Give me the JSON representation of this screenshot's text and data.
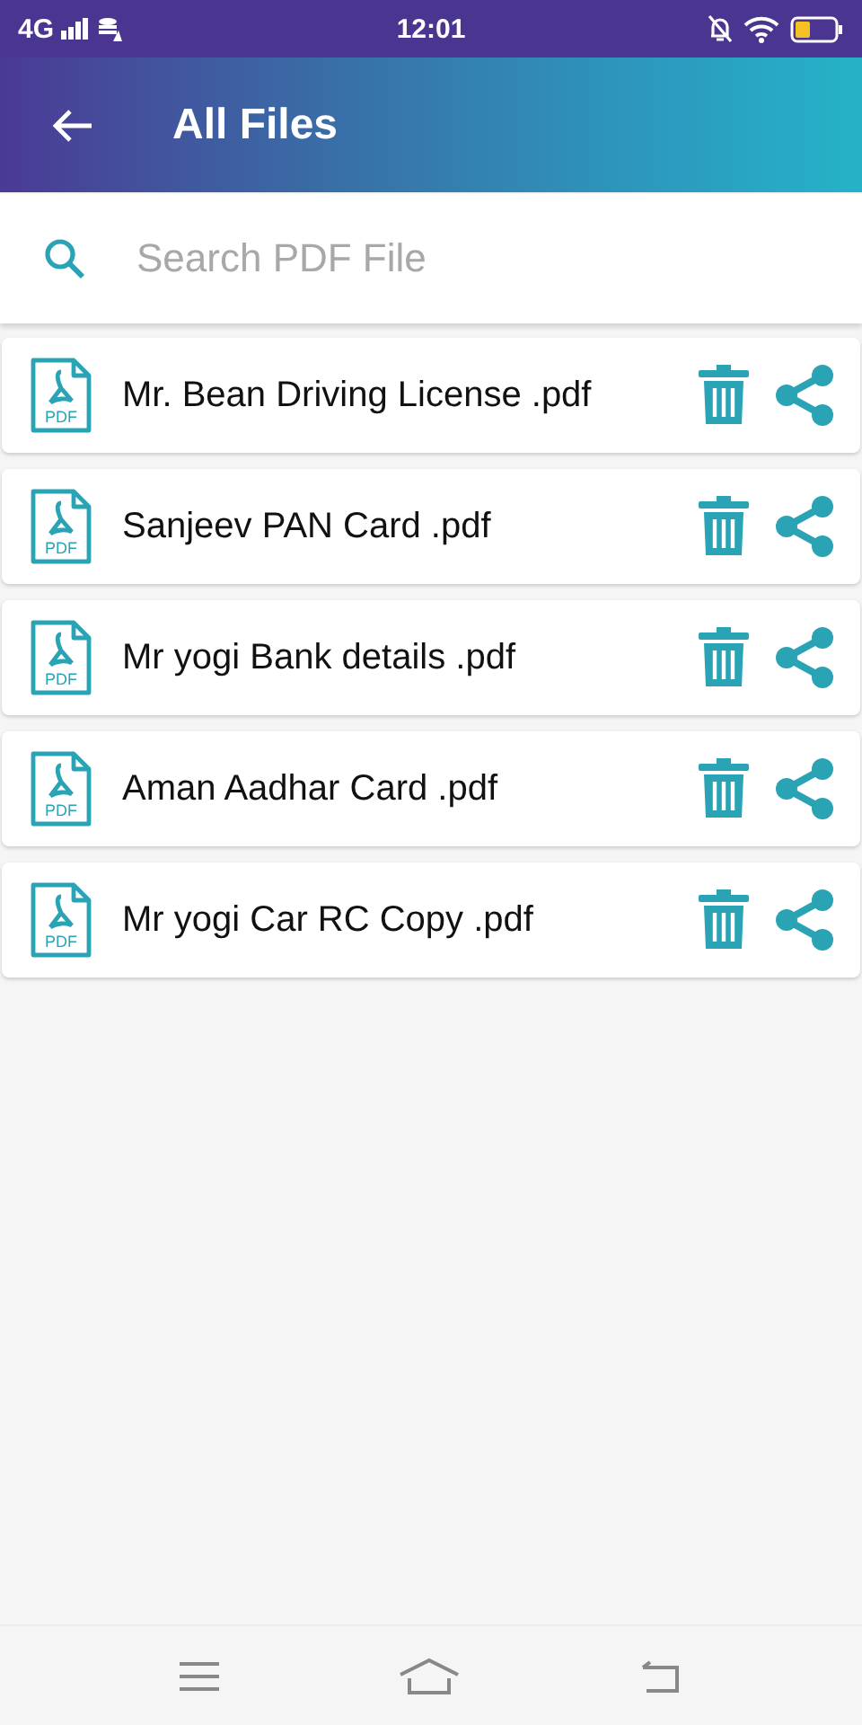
{
  "status_bar": {
    "network": "4G",
    "time": "12:01"
  },
  "app_bar": {
    "title": "All Files"
  },
  "search": {
    "placeholder": "Search PDF File"
  },
  "files": [
    {
      "name": "Mr. Bean Driving License .pdf",
      "icon_label": "PDF"
    },
    {
      "name": "Sanjeev PAN Card .pdf",
      "icon_label": "PDF"
    },
    {
      "name": "Mr yogi Bank details .pdf",
      "icon_label": "PDF"
    },
    {
      "name": "Aman Aadhar Card .pdf",
      "icon_label": "PDF"
    },
    {
      "name": "Mr yogi Car RC Copy .pdf",
      "icon_label": "PDF"
    }
  ]
}
